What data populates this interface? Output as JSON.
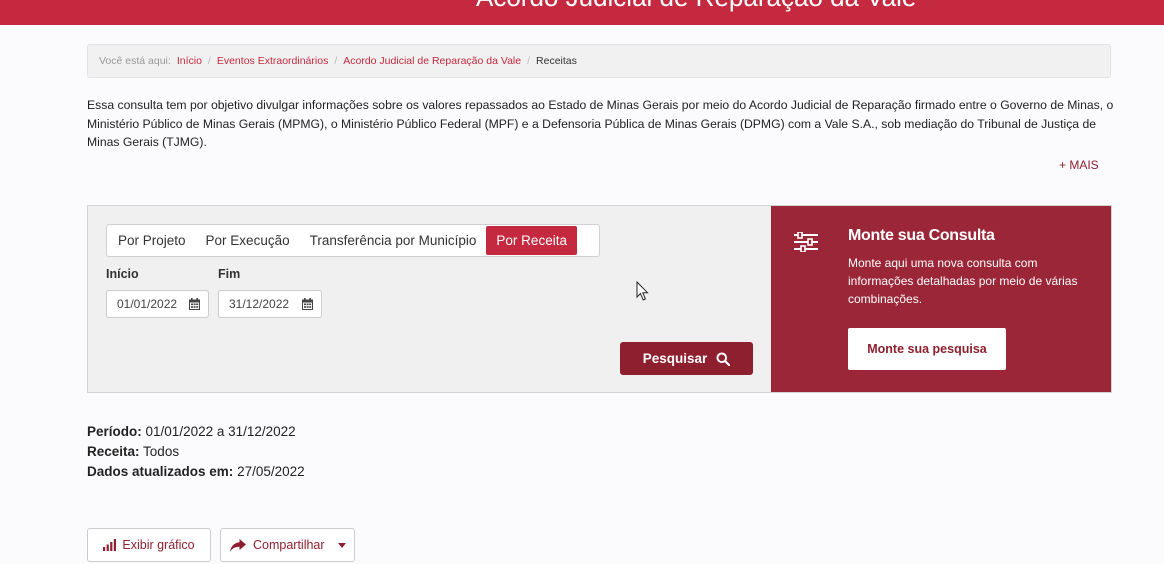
{
  "header": {
    "title": "Acordo Judicial de Reparação da Vale"
  },
  "breadcrumb": {
    "prefix": "Você está aqui:",
    "items": [
      "Início",
      "Eventos Extraordinários",
      "Acordo Judicial de Reparação da Vale"
    ],
    "current": "Receitas"
  },
  "intro": {
    "text": "Essa consulta tem por objetivo divulgar informações sobre os valores repassados ao Estado de Minas Gerais por meio do Acordo Judicial de Reparação firmado entre o Governo de Minas, o Ministério Público de Minas Gerais (MPMG), o Ministério Público Federal (MPF) e a Defensoria Pública de Minas Gerais (DPMG) com a Vale S.A., sob mediação do Tribunal de Justiça de Minas Gerais (TJMG).",
    "more": "+ MAIS"
  },
  "search": {
    "tabs": [
      "Por Projeto",
      "Por Execução",
      "Transferência por Município",
      "Por Receita"
    ],
    "active_tab": "Por Receita",
    "start_label": "Início",
    "start_value": "01/01/2022",
    "end_label": "Fim",
    "end_value": "31/12/2022",
    "button": "Pesquisar"
  },
  "card": {
    "title": "Monte sua Consulta",
    "text": "Monte aqui uma nova consulta com informações detalhadas por meio de várias combinações.",
    "button": "Monte sua pesquisa"
  },
  "summary": {
    "period_label": "Período:",
    "period_value": "01/01/2022 a 31/12/2022",
    "receita_label": "Receita:",
    "receita_value": "Todos",
    "updated_label": "Dados atualizados em:",
    "updated_value": "27/05/2022"
  },
  "actions": {
    "chart": "Exibir gráfico",
    "share": "Compartilhar"
  },
  "colors": {
    "brand": "#c4293f",
    "dark_brand": "#8e1f2e",
    "card_bg": "#9b2637"
  }
}
